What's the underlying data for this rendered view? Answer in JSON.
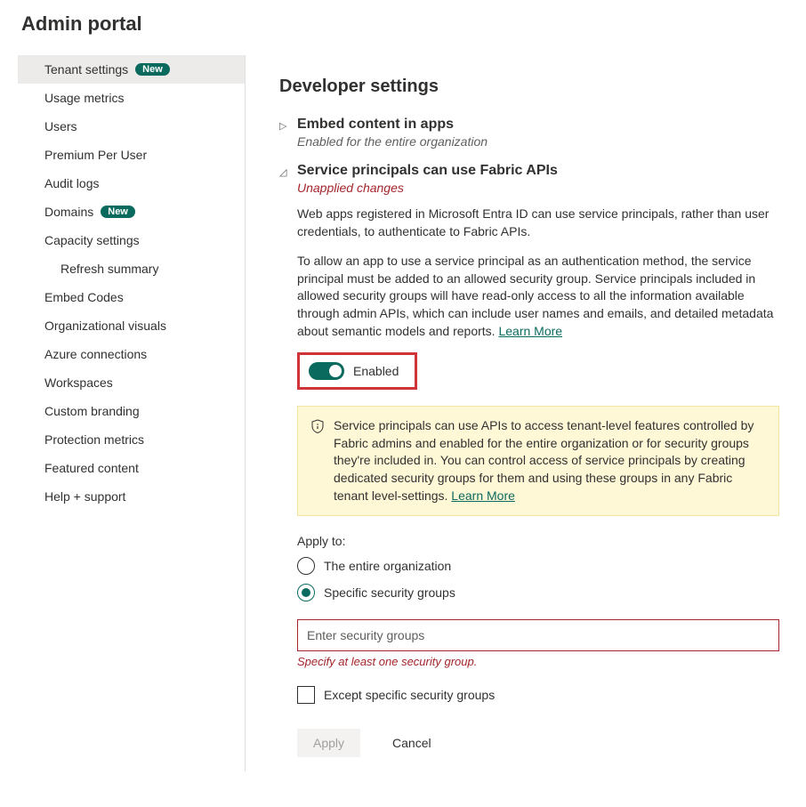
{
  "page_title": "Admin portal",
  "sidebar": {
    "items": [
      {
        "label": "Tenant settings",
        "badge": "New",
        "selected": true
      },
      {
        "label": "Usage metrics"
      },
      {
        "label": "Users"
      },
      {
        "label": "Premium Per User"
      },
      {
        "label": "Audit logs"
      },
      {
        "label": "Domains",
        "badge": "New"
      },
      {
        "label": "Capacity settings"
      },
      {
        "label": "Refresh summary",
        "sub": true
      },
      {
        "label": "Embed Codes"
      },
      {
        "label": "Organizational visuals"
      },
      {
        "label": "Azure connections"
      },
      {
        "label": "Workspaces"
      },
      {
        "label": "Custom branding"
      },
      {
        "label": "Protection metrics"
      },
      {
        "label": "Featured content"
      },
      {
        "label": "Help + support"
      }
    ]
  },
  "main": {
    "section_title": "Developer settings",
    "setting1": {
      "title": "Embed content in apps",
      "sub": "Enabled for the entire organization"
    },
    "setting2": {
      "title": "Service principals can use Fabric APIs",
      "sub": "Unapplied changes",
      "p1": "Web apps registered in Microsoft Entra ID can use service principals, rather than user credentials, to authenticate to Fabric APIs.",
      "p2": "To allow an app to use a service principal as an authentication method, the service principal must be added to an allowed security group. Service principals included in allowed security groups will have read-only access to all the information available through admin APIs, which can include user names and emails, and detailed metadata about semantic models and reports. ",
      "learn_more": "Learn More",
      "toggle_label": "Enabled",
      "banner": "Service principals can use APIs to access tenant-level features controlled by Fabric admins and enabled for the entire organization or for security groups they're included in. You can control access of service principals by creating dedicated security groups for them and using these groups in any Fabric tenant level-settings. ",
      "banner_link": "Learn More",
      "apply_to_label": "Apply to:",
      "radio1": "The entire organization",
      "radio2": "Specific security groups",
      "input_placeholder": "Enter security groups",
      "input_error": "Specify at least one security group.",
      "checkbox_label": "Except specific security groups",
      "apply_btn": "Apply",
      "cancel_btn": "Cancel"
    }
  }
}
